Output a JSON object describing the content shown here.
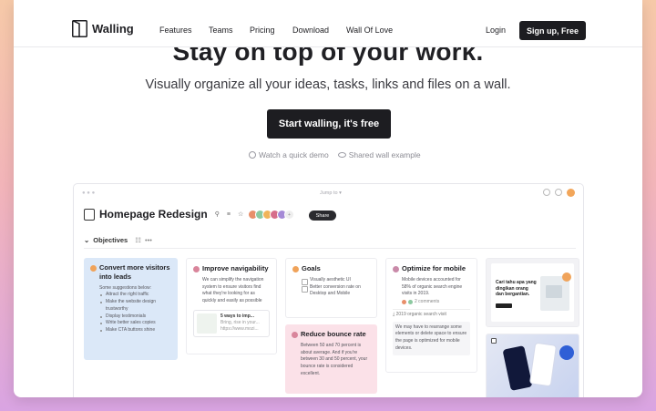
{
  "brand": {
    "name": "Walling"
  },
  "nav": {
    "items": [
      "Features",
      "Teams",
      "Pricing",
      "Download",
      "Wall Of Love"
    ],
    "login": "Login",
    "signup": "Sign up, Free"
  },
  "hero": {
    "title": "Stay on top of your work.",
    "subtitle": "Visually organize all your ideas, tasks, links and files on a wall.",
    "cta": "Start walling, it's free",
    "demo_link": "Watch a quick demo",
    "example_link": "Shared wall example"
  },
  "app": {
    "jump": "Jump to",
    "wall_title": "Homepage Redesign",
    "people_extra": "+",
    "share": "Share",
    "section": "Objectives",
    "cards": {
      "leads": {
        "title": "Convert more visitors into leads",
        "intro": "Some suggestions below:",
        "bullets": [
          "Attract the right traffic",
          "Make the website design trustworthy",
          "Display testimonials",
          "Write better sales copies",
          "Make CTA buttons shine"
        ]
      },
      "nav": {
        "title": "Improve navigability",
        "body": "We can simplify the navigation system to ensure visitors find what they're looking for as quickly and easily as possible",
        "link_title": "5 ways to imp...",
        "link_sub": "Bring, rise in your...",
        "link_url": "https://www.mozi..."
      },
      "goals": {
        "title": "Goals",
        "checks": [
          "Visually aesthetic UI",
          "Better conversion rate on Desktop and Mobile"
        ]
      },
      "bounce": {
        "title": "Reduce bounce rate",
        "body": "Between 50 and 70 percent is about average. And if you're between 30 and 50 percent, your bounce rate is considered excellent."
      },
      "mobile": {
        "title": "Optimize for mobile",
        "body": "Mobile devices accounted for 58% of organic search engine visits in 2019.",
        "comments": "2 comments",
        "file": "2019 organic search visit",
        "note": "We may have to rearrange some elements or delete space to ensure the page is optimized for mobile devices."
      },
      "image1": {
        "heading": "Cari tahu apa yang dingikan orang dan bergantian."
      }
    }
  }
}
